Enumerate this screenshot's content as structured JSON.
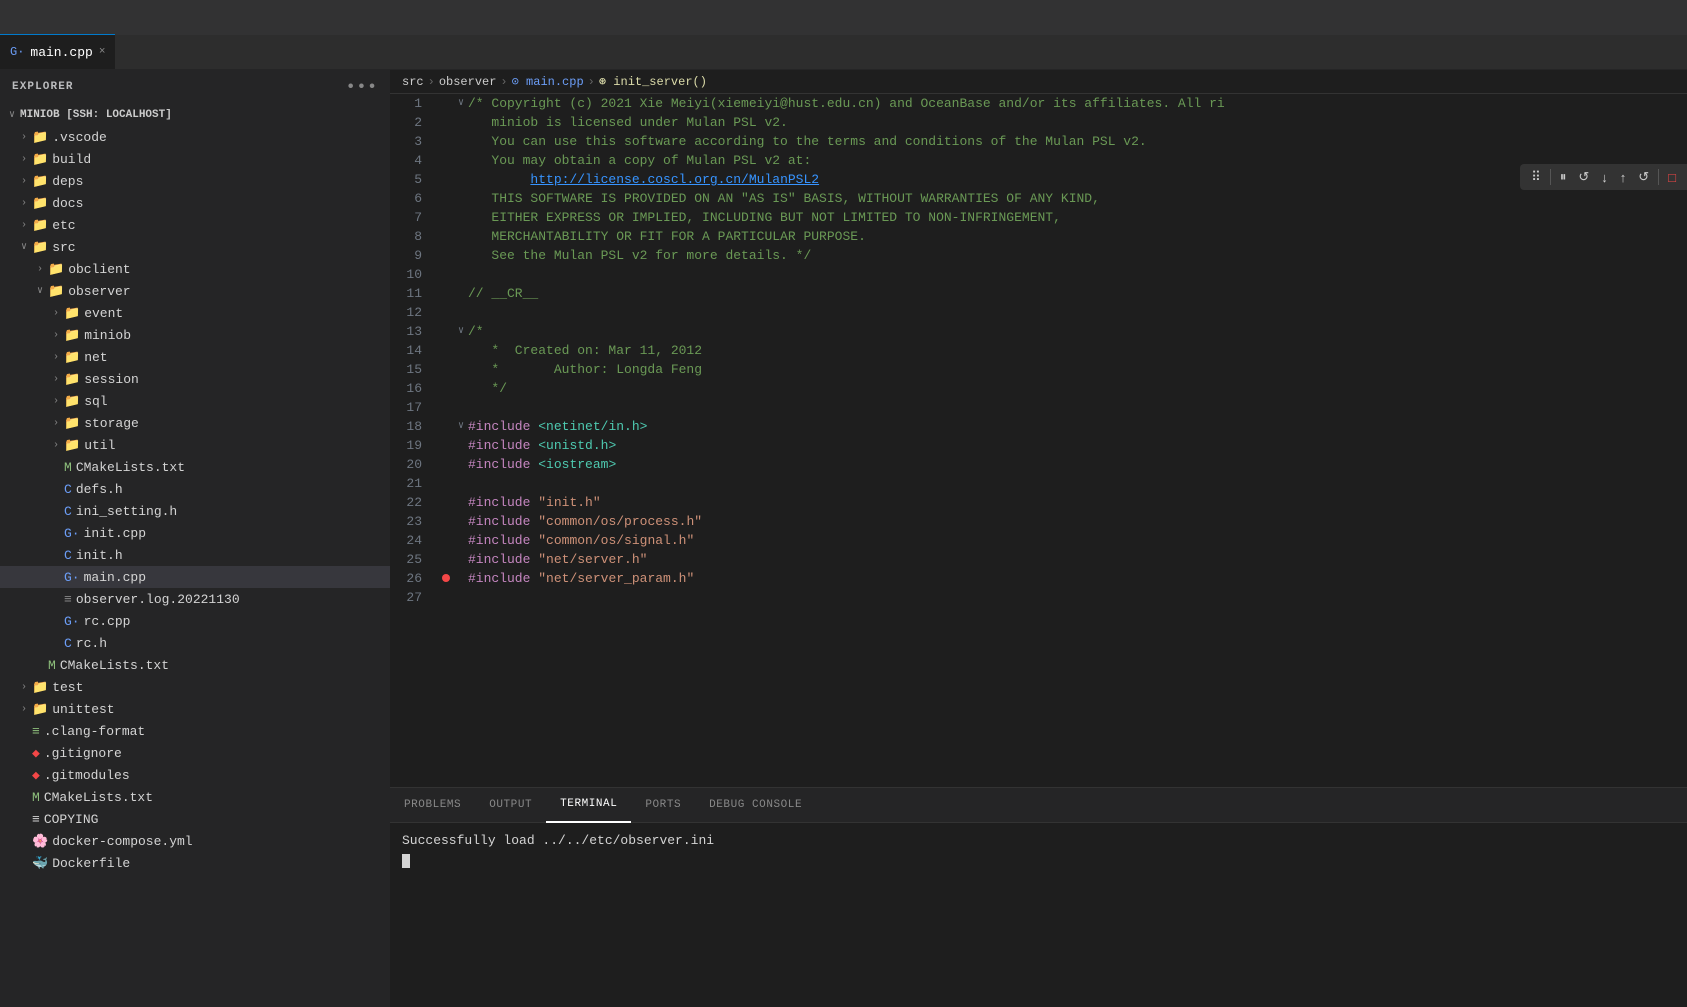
{
  "app": {
    "title": "EXPLORER",
    "dots_label": "•••"
  },
  "tab": {
    "label": "main.cpp",
    "icon": "G·",
    "close": "×"
  },
  "breadcrumb": {
    "parts": [
      "src",
      ">",
      "observer",
      ">",
      "main.cpp",
      ">",
      "init_server()"
    ]
  },
  "sidebar": {
    "root_label": "MINIOB [SSH: LOCALHOST]",
    "items": [
      {
        "id": "vscode",
        "label": ".vscode",
        "type": "folder",
        "indent": 1,
        "open": false
      },
      {
        "id": "build",
        "label": "build",
        "type": "folder",
        "indent": 1,
        "open": false
      },
      {
        "id": "deps",
        "label": "deps",
        "type": "folder",
        "indent": 1,
        "open": false
      },
      {
        "id": "docs",
        "label": "docs",
        "type": "folder",
        "indent": 1,
        "open": false
      },
      {
        "id": "etc",
        "label": "etc",
        "type": "folder",
        "indent": 1,
        "open": false
      },
      {
        "id": "src",
        "label": "src",
        "type": "folder",
        "indent": 1,
        "open": true
      },
      {
        "id": "obclient",
        "label": "obclient",
        "type": "folder",
        "indent": 2,
        "open": false
      },
      {
        "id": "observer",
        "label": "observer",
        "type": "folder",
        "indent": 2,
        "open": true
      },
      {
        "id": "event",
        "label": "event",
        "type": "folder",
        "indent": 3,
        "open": false
      },
      {
        "id": "miniob",
        "label": "miniob",
        "type": "folder",
        "indent": 3,
        "open": false
      },
      {
        "id": "net",
        "label": "net",
        "type": "folder",
        "indent": 3,
        "open": false
      },
      {
        "id": "session",
        "label": "session",
        "type": "folder",
        "indent": 3,
        "open": false
      },
      {
        "id": "sql",
        "label": "sql",
        "type": "folder",
        "indent": 3,
        "open": false
      },
      {
        "id": "storage",
        "label": "storage",
        "type": "folder",
        "indent": 3,
        "open": false
      },
      {
        "id": "util",
        "label": "util",
        "type": "folder",
        "indent": 3,
        "open": false
      },
      {
        "id": "cmakelists-observer",
        "label": "CMakeLists.txt",
        "type": "file-m",
        "indent": 3
      },
      {
        "id": "defs-h",
        "label": "defs.h",
        "type": "file-c",
        "indent": 3
      },
      {
        "id": "ini-setting-h",
        "label": "ini_setting.h",
        "type": "file-c",
        "indent": 3
      },
      {
        "id": "init-cpp",
        "label": "init.cpp",
        "type": "file-cpp",
        "indent": 3
      },
      {
        "id": "init-h",
        "label": "init.h",
        "type": "file-c",
        "indent": 3
      },
      {
        "id": "main-cpp",
        "label": "main.cpp",
        "type": "file-cpp",
        "indent": 3,
        "active": true
      },
      {
        "id": "observer-log",
        "label": "observer.log.20221130",
        "type": "file-log",
        "indent": 3
      },
      {
        "id": "rc-cpp",
        "label": "rc.cpp",
        "type": "file-cpp",
        "indent": 3
      },
      {
        "id": "rc-h",
        "label": "rc.h",
        "type": "file-c",
        "indent": 3
      },
      {
        "id": "cmakelists-src",
        "label": "CMakeLists.txt",
        "type": "file-m",
        "indent": 2
      },
      {
        "id": "test",
        "label": "test",
        "type": "folder",
        "indent": 1,
        "open": false
      },
      {
        "id": "unittest",
        "label": "unittest",
        "type": "folder",
        "indent": 1,
        "open": false
      },
      {
        "id": "clang-format",
        "label": ".clang-format",
        "type": "file-clang",
        "indent": 1
      },
      {
        "id": "gitignore",
        "label": ".gitignore",
        "type": "file-git",
        "indent": 1
      },
      {
        "id": "gitmodules",
        "label": ".gitmodules",
        "type": "file-git",
        "indent": 1
      },
      {
        "id": "cmakelists-root",
        "label": "CMakeLists.txt",
        "type": "file-m",
        "indent": 1
      },
      {
        "id": "copying",
        "label": "COPYING",
        "type": "file-copy",
        "indent": 1
      },
      {
        "id": "docker-compose",
        "label": "docker-compose.yml",
        "type": "file-yaml",
        "indent": 1
      },
      {
        "id": "dockerfile",
        "label": "Dockerfile",
        "type": "file-docker",
        "indent": 1
      }
    ]
  },
  "debug_toolbar": {
    "buttons": [
      "⠿",
      "⏸",
      "↺",
      "↓",
      "↑",
      "↺",
      "□"
    ]
  },
  "code_lines": [
    {
      "num": "1",
      "fold": "∨",
      "error": false,
      "content": "/* Copyright (c) 2021 Xie Meiyi(xiemeiyi@hust.edu.cn) and OceanBase and/or its affiliates. All ri",
      "type": "comment"
    },
    {
      "num": "2",
      "fold": " ",
      "error": false,
      "content": "   miniob is licensed under Mulan PSL v2.",
      "type": "comment"
    },
    {
      "num": "3",
      "fold": " ",
      "error": false,
      "content": "   You can use this software according to the terms and conditions of the Mulan PSL v2.",
      "type": "comment"
    },
    {
      "num": "4",
      "fold": " ",
      "error": false,
      "content": "   You may obtain a copy of Mulan PSL v2 at:",
      "type": "comment"
    },
    {
      "num": "5",
      "fold": " ",
      "error": false,
      "content_url": "        http://license.coscl.org.cn/MulanPSL2",
      "type": "url"
    },
    {
      "num": "6",
      "fold": " ",
      "error": false,
      "content": "   THIS SOFTWARE IS PROVIDED ON AN \"AS IS\" BASIS, WITHOUT WARRANTIES OF ANY KIND,",
      "type": "comment"
    },
    {
      "num": "7",
      "fold": " ",
      "error": false,
      "content": "   EITHER EXPRESS OR IMPLIED, INCLUDING BUT NOT LIMITED TO NON-INFRINGEMENT,",
      "type": "comment"
    },
    {
      "num": "8",
      "fold": " ",
      "error": false,
      "content": "   MERCHANTABILITY OR FIT FOR A PARTICULAR PURPOSE.",
      "type": "comment"
    },
    {
      "num": "9",
      "fold": " ",
      "error": false,
      "content": "   See the Mulan PSL v2 for more details. */",
      "type": "comment"
    },
    {
      "num": "10",
      "fold": " ",
      "error": false,
      "content": "",
      "type": "plain"
    },
    {
      "num": "11",
      "fold": " ",
      "error": false,
      "content": "// __CR__",
      "type": "comment"
    },
    {
      "num": "12",
      "fold": " ",
      "error": false,
      "content": "",
      "type": "plain"
    },
    {
      "num": "13",
      "fold": "∨",
      "error": false,
      "content": "/*",
      "type": "comment"
    },
    {
      "num": "14",
      "fold": " ",
      "error": false,
      "content": "   *  Created on: Mar 11, 2012",
      "type": "comment"
    },
    {
      "num": "15",
      "fold": " ",
      "error": false,
      "content": "   *       Author: Longda Feng",
      "type": "comment"
    },
    {
      "num": "16",
      "fold": " ",
      "error": false,
      "content": "   */",
      "type": "comment"
    },
    {
      "num": "17",
      "fold": " ",
      "error": false,
      "content": "",
      "type": "plain"
    },
    {
      "num": "18",
      "fold": "∨",
      "error": false,
      "content_include": "#include <netinet/in.h>",
      "type": "include"
    },
    {
      "num": "19",
      "fold": " ",
      "error": false,
      "content_include": "#include <unistd.h>",
      "type": "include"
    },
    {
      "num": "20",
      "fold": " ",
      "error": false,
      "content_include": "#include <iostream>",
      "type": "include"
    },
    {
      "num": "21",
      "fold": " ",
      "error": false,
      "content": "",
      "type": "plain"
    },
    {
      "num": "22",
      "fold": " ",
      "error": false,
      "content_include2": "#include \"init.h\"",
      "type": "include2"
    },
    {
      "num": "23",
      "fold": " ",
      "error": false,
      "content_include2": "#include \"common/os/process.h\"",
      "type": "include2"
    },
    {
      "num": "24",
      "fold": " ",
      "error": false,
      "content_include2": "#include \"common/os/signal.h\"",
      "type": "include2"
    },
    {
      "num": "25",
      "fold": " ",
      "error": false,
      "content_include2": "#include \"net/server.h\"",
      "type": "include2"
    },
    {
      "num": "26",
      "fold": " ",
      "error": true,
      "content_include2": "#include \"net/server_param.h\"",
      "type": "include2"
    },
    {
      "num": "27",
      "fold": " ",
      "error": false,
      "content": "",
      "type": "plain"
    }
  ],
  "panel_tabs": [
    {
      "id": "problems",
      "label": "PROBLEMS",
      "active": false
    },
    {
      "id": "output",
      "label": "OUTPUT",
      "active": false
    },
    {
      "id": "terminal",
      "label": "TERMINAL",
      "active": true
    },
    {
      "id": "ports",
      "label": "PORTS",
      "active": false
    },
    {
      "id": "debug-console",
      "label": "DEBUG CONSOLE",
      "active": false
    }
  ],
  "terminal": {
    "output_line": "Successfully load ../../etc/observer.ini",
    "prompt": ""
  }
}
